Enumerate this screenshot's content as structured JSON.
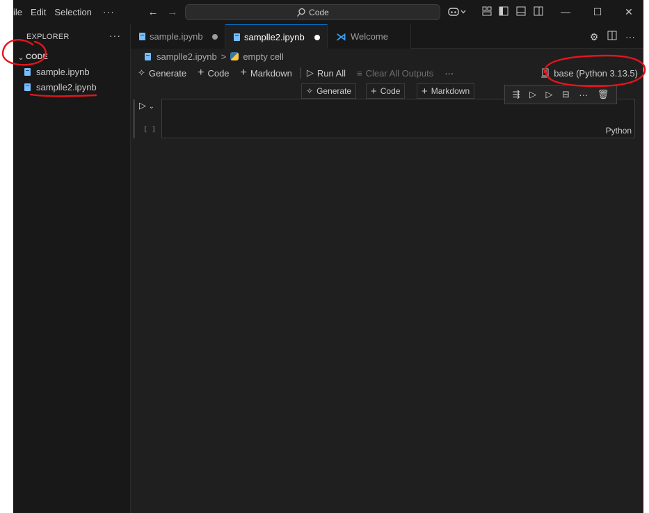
{
  "menu": {
    "file": "ile",
    "edit": "Edit",
    "selection": "Selection",
    "more": "···"
  },
  "command_center": {
    "label": "Code"
  },
  "window": {
    "minimize": "—",
    "maximize": "☐",
    "close": "✕"
  },
  "sidebar": {
    "title": "EXPLORER",
    "more": "···",
    "folder": "CODE",
    "files": [
      {
        "label": "sample.ipynb"
      },
      {
        "label": "samplle2.ipynb"
      }
    ]
  },
  "tabs": [
    {
      "label": "sample.ipynb",
      "dirty": true
    },
    {
      "label": "samplle2.ipynb",
      "dirty": true,
      "active": true
    },
    {
      "label": "Welcome"
    }
  ],
  "breadcrumb": {
    "file": "samplle2.ipynb",
    "separator": ">",
    "cell": "empty cell"
  },
  "toolbar": {
    "generate": "Generate",
    "code": "Code",
    "markdown": "Markdown",
    "run_all": "Run All",
    "clear_outputs": "Clear All Outputs",
    "more": "···",
    "kernel": "base (Python 3.13.5)"
  },
  "insert_bar": {
    "generate": "Generate",
    "code": "Code",
    "markdown": "Markdown"
  },
  "cell": {
    "count": "[ ]",
    "language": "Python"
  },
  "colors": {
    "accent": "#0078d4",
    "annotation": "#e5141c",
    "background": "#1f1f1f"
  }
}
